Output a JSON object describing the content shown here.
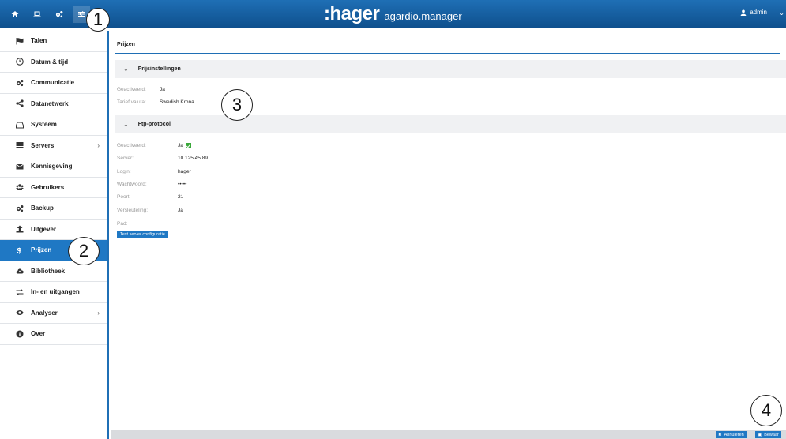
{
  "header": {
    "logo": ":hager",
    "product": "agardio.manager",
    "user": "admin",
    "icons": [
      "home-icon",
      "laptop-icon",
      "gears-icon",
      "sliders-icon"
    ]
  },
  "sidebar": {
    "items": [
      {
        "label": "Talen",
        "icon": "flag-icon"
      },
      {
        "label": "Datum & tijd",
        "icon": "clock-icon"
      },
      {
        "label": "Communicatie",
        "icon": "gears-icon"
      },
      {
        "label": "Datanetwerk",
        "icon": "share-icon"
      },
      {
        "label": "Systeem",
        "icon": "hdd-icon"
      },
      {
        "label": "Servers",
        "icon": "server-icon",
        "has_submenu": true
      },
      {
        "label": "Kennisgeving",
        "icon": "envelope-icon"
      },
      {
        "label": "Gebruikers",
        "icon": "users-icon"
      },
      {
        "label": "Backup",
        "icon": "gears-icon"
      },
      {
        "label": "Uitgever",
        "icon": "upload-icon"
      },
      {
        "label": "Prijzen",
        "icon": "dollar-icon",
        "active": true
      },
      {
        "label": "Bibliotheek",
        "icon": "cloud-icon"
      },
      {
        "label": "In- en uitgangen",
        "icon": "exchange-icon"
      },
      {
        "label": "Analyser",
        "icon": "eye-icon",
        "has_submenu": true
      },
      {
        "label": "Over",
        "icon": "info-icon"
      }
    ]
  },
  "main": {
    "tab": "Prijzen",
    "price_settings": {
      "title": "Prijsinstellingen",
      "enabled_label": "Geactiveerd:",
      "enabled_value": "Ja",
      "currency_label": "Tarief valuta:",
      "currency_value": "Swedish Krona"
    },
    "ftp": {
      "title": "Ftp-protocol",
      "enabled_label": "Geactiveerd:",
      "enabled_value": "Ja",
      "server_label": "Server:",
      "server_value": "10.125.45.89",
      "login_label": "Login:",
      "login_value": "hager",
      "password_label": "Wachtwoord:",
      "password_value": "•••••",
      "port_label": "Poort:",
      "port_value": "21",
      "encryption_label": "Versleuteling:",
      "encryption_value": "Ja",
      "path_label": "Pad:",
      "test_button": "Test server configuratie"
    }
  },
  "footer": {
    "cancel": "Annuleren",
    "save": "Bewaar"
  },
  "callouts": [
    "1",
    "2",
    "3",
    "4"
  ],
  "colors": {
    "accent": "#1f78c4",
    "header": "#1f6fb5",
    "success": "#3aa83a"
  }
}
